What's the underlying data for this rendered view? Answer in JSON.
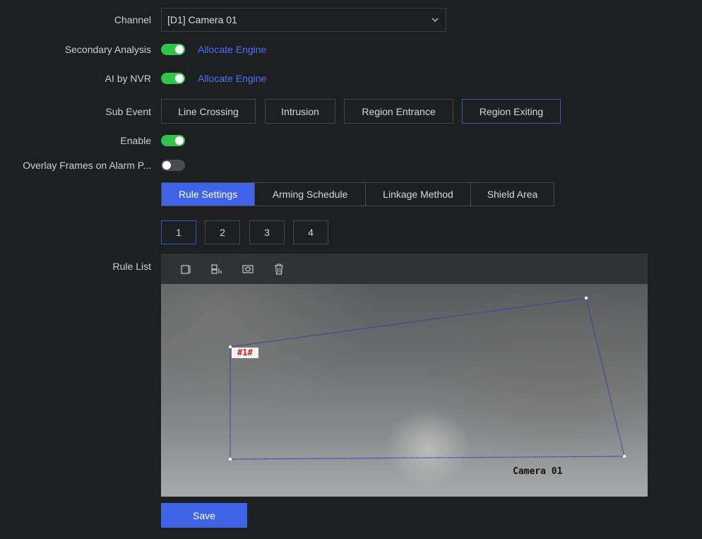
{
  "channel": {
    "label": "Channel",
    "value": "[D1] Camera 01"
  },
  "secondary_analysis": {
    "label": "Secondary Analysis",
    "state": "on",
    "link": "Allocate Engine"
  },
  "ai_by_nvr": {
    "label": "AI by NVR",
    "state": "on",
    "link": "Allocate Engine"
  },
  "sub_event": {
    "label": "Sub Event",
    "buttons": [
      "Line Crossing",
      "Intrusion",
      "Region Entrance",
      "Region Exiting"
    ],
    "selected": "Region Exiting"
  },
  "enable": {
    "label": "Enable",
    "state": "on"
  },
  "overlay": {
    "label": "Overlay Frames on Alarm P...",
    "state": "off"
  },
  "tabs": [
    "Rule Settings",
    "Arming Schedule",
    "Linkage Method",
    "Shield Area"
  ],
  "active_tab": "Rule Settings",
  "rules": [
    "1",
    "2",
    "3",
    "4"
  ],
  "active_rule": "1",
  "rule_list": {
    "label": "Rule List",
    "tools": [
      "draw-region-icon",
      "draw-max-size-icon",
      "draw-min-size-icon",
      "delete-icon"
    ],
    "region_tag": "#1#",
    "osd_text": "Camera 01"
  },
  "save_label": "Save",
  "colors": {
    "accent": "#3f63e6",
    "link": "#4a72ff",
    "toggle_on": "#2fc44a",
    "region_line": "#2c3bb0",
    "background": "#1e1f21"
  }
}
